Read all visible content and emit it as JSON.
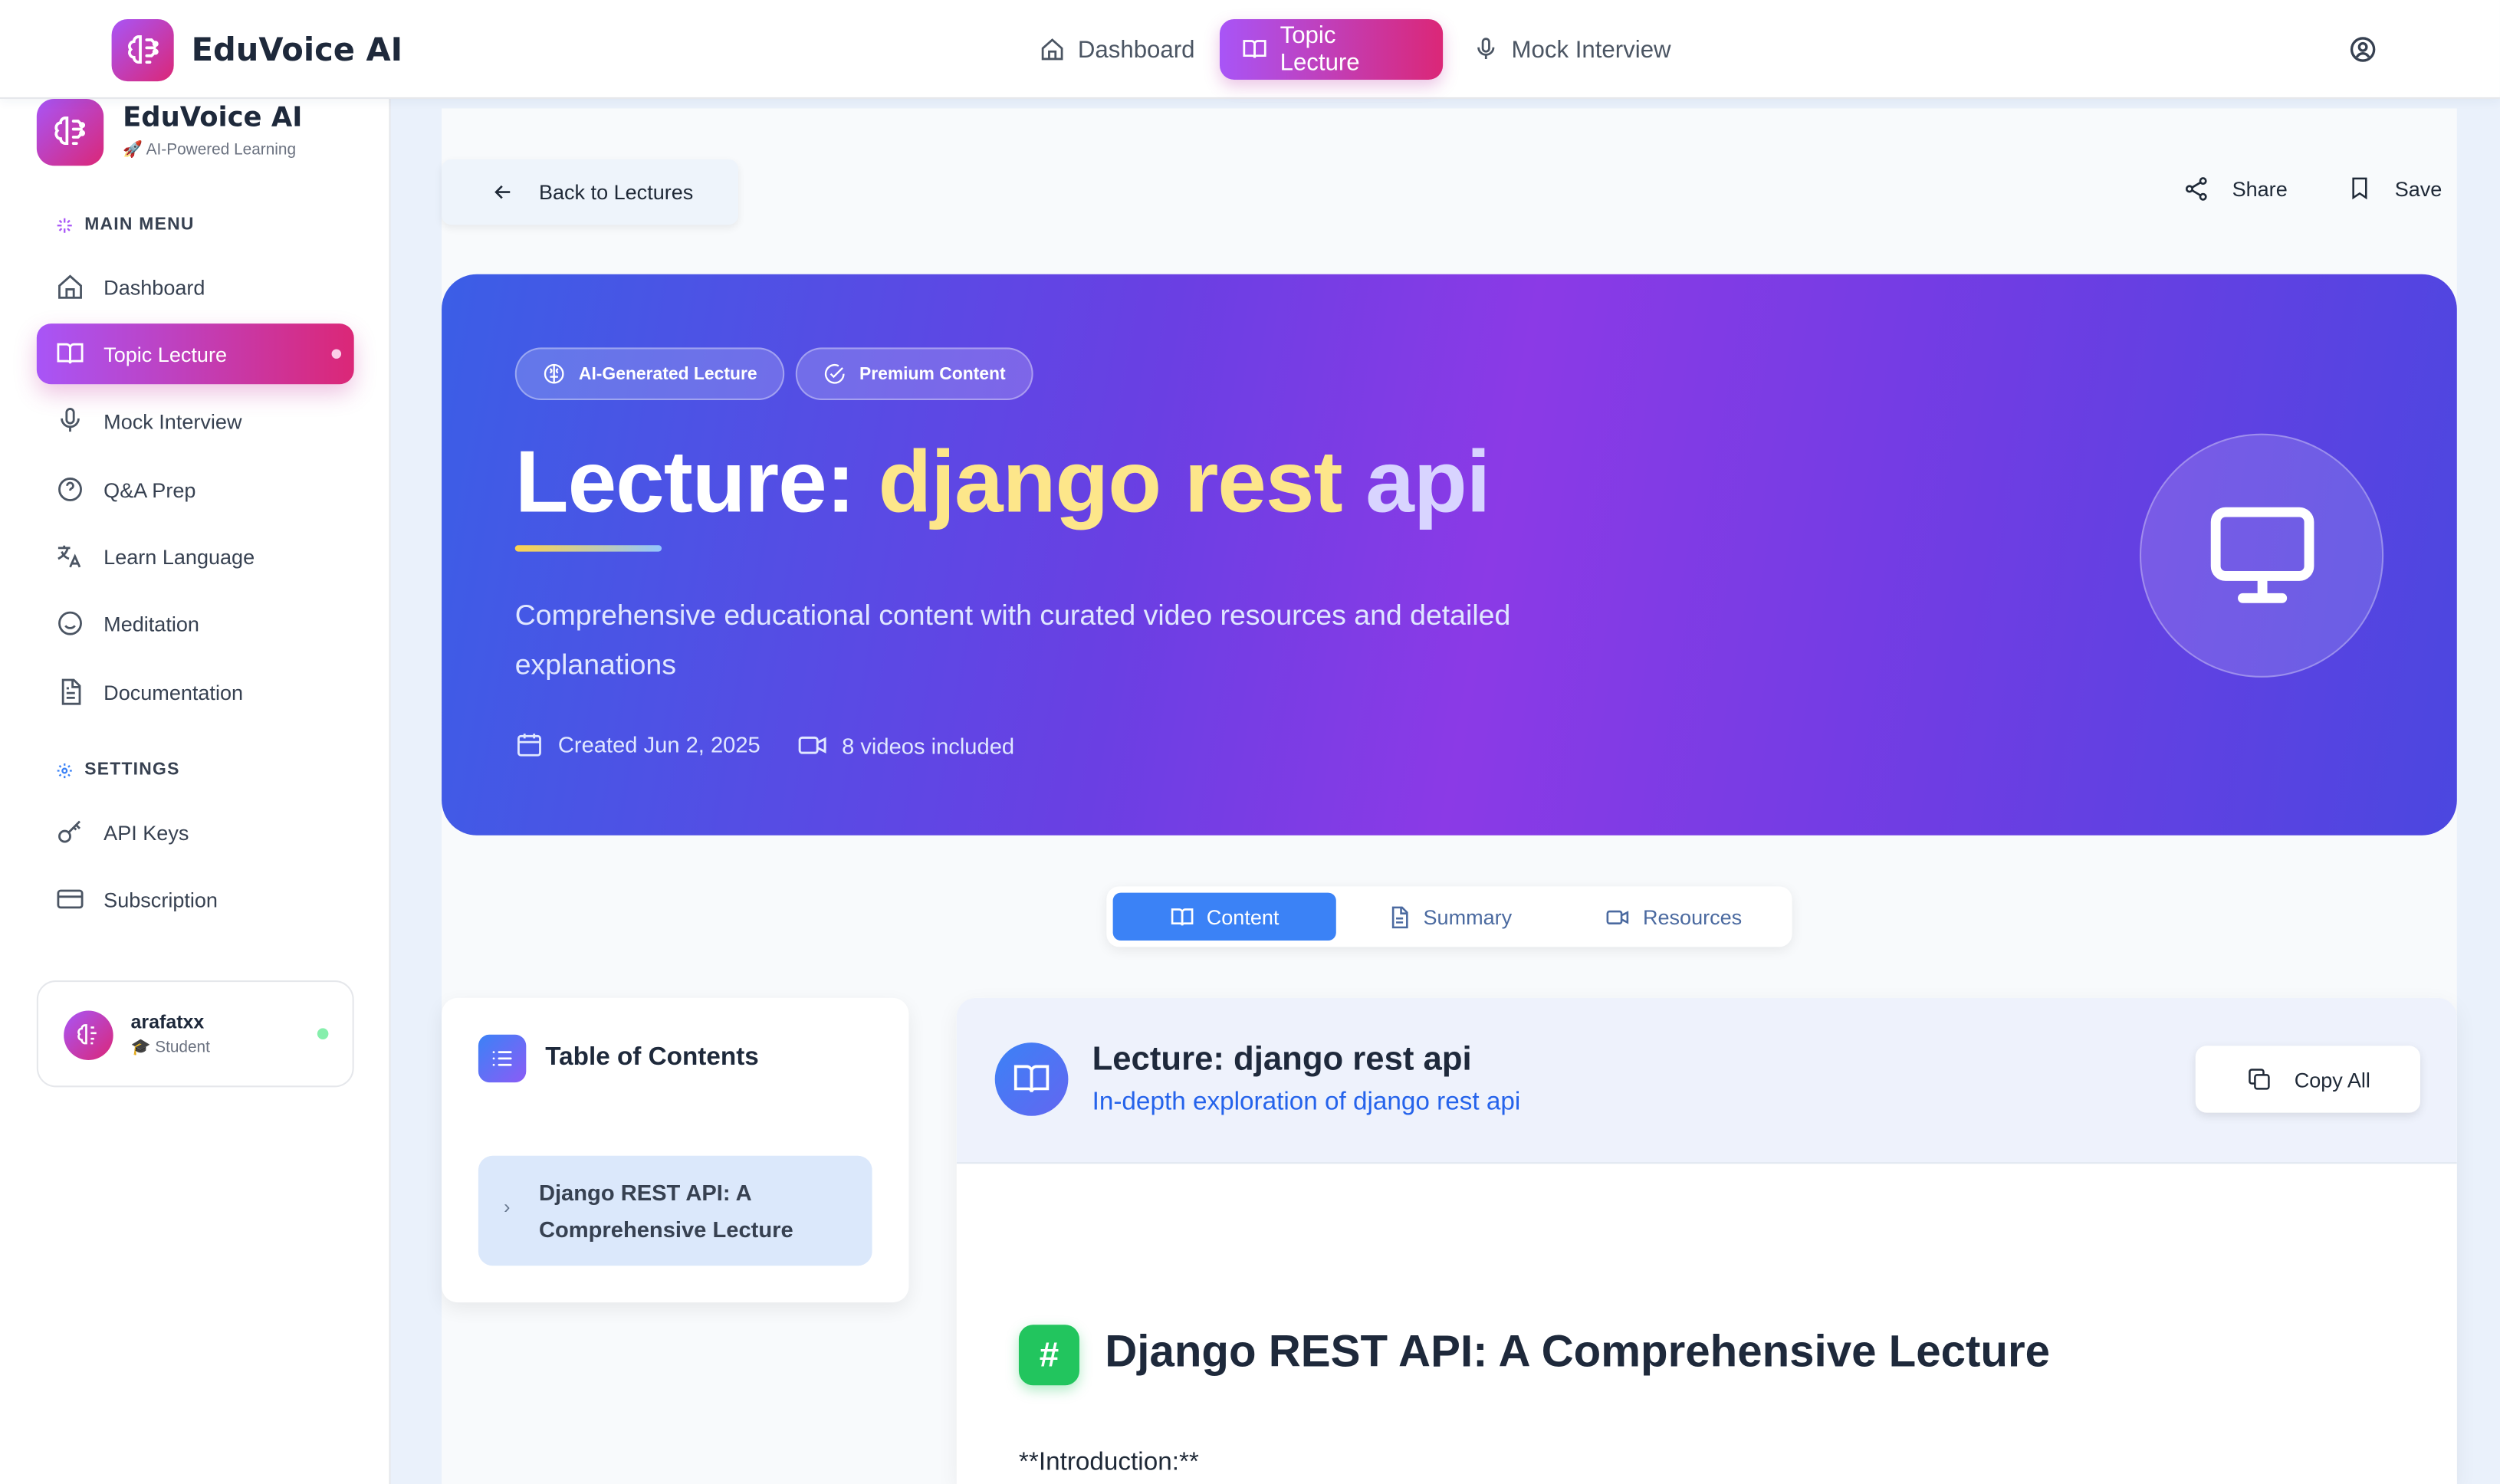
{
  "topbar": {
    "brand": "EduVoice AI",
    "nav": [
      {
        "label": "Dashboard",
        "icon": "home-icon"
      },
      {
        "label": "Topic Lecture",
        "icon": "book-icon",
        "active": true
      },
      {
        "label": "Mock Interview",
        "icon": "mic-icon"
      }
    ],
    "user_icon": "user-circle-icon"
  },
  "sidebar": {
    "brand": "EduVoice AI",
    "tagline": "🚀 AI-Powered Learning",
    "main_menu_label": "MAIN MENU",
    "items": [
      {
        "label": "Dashboard",
        "icon": "home-icon"
      },
      {
        "label": "Topic Lecture",
        "icon": "book-icon",
        "active": true
      },
      {
        "label": "Mock Interview",
        "icon": "mic-icon"
      },
      {
        "label": "Q&A Prep",
        "icon": "help-circle-icon"
      },
      {
        "label": "Learn Language",
        "icon": "translate-icon"
      },
      {
        "label": "Meditation",
        "icon": "smile-icon"
      },
      {
        "label": "Documentation",
        "icon": "document-icon"
      }
    ],
    "settings_label": "SETTINGS",
    "settings_items": [
      {
        "label": "API Keys",
        "icon": "key-icon"
      },
      {
        "label": "Subscription",
        "icon": "credit-card-icon"
      }
    ],
    "user": {
      "name": "arafatxx",
      "role": "🎓 Student",
      "status": "online"
    }
  },
  "header": {
    "back_label": "Back to Lectures",
    "share_label": "Share",
    "save_label": "Save"
  },
  "hero": {
    "badges": [
      "AI-Generated Lecture",
      "Premium Content"
    ],
    "title_prefix": "Lecture: ",
    "title_word1": "django rest",
    "title_word2": " api",
    "description": "Comprehensive educational content with curated video resources and detailed explanations",
    "created": "Created Jun 2, 2025",
    "videos": "8 videos included"
  },
  "tabs": [
    {
      "label": "Content",
      "icon": "book-icon",
      "active": true
    },
    {
      "label": "Summary",
      "icon": "document-icon"
    },
    {
      "label": "Resources",
      "icon": "video-icon"
    }
  ],
  "toc": {
    "title": "Table of Contents",
    "items": [
      "Django REST API: A Comprehensive Lecture"
    ]
  },
  "content": {
    "title": "Lecture: django rest api",
    "subtitle": "In-depth exploration of django rest api",
    "copy_label": "Copy All",
    "heading_marker": "#",
    "heading": "Django REST API: A Comprehensive Lecture",
    "intro": "**Introduction:**"
  },
  "colors": {
    "accent_gradient_start": "#a855f7",
    "accent_gradient_end": "#db2777",
    "tab_active": "#3b82f6",
    "hero_title_highlight": "#fde68a"
  }
}
